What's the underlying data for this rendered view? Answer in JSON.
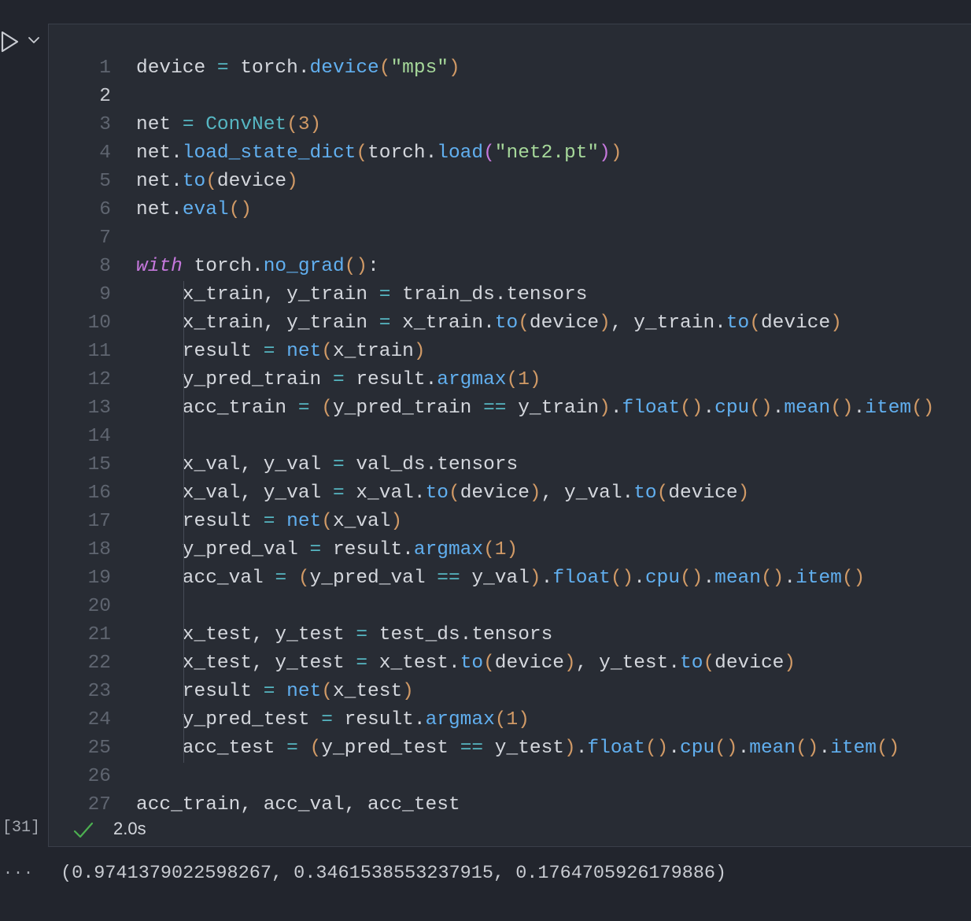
{
  "cell": {
    "execution_count": "[31]",
    "status_time": "2.0s",
    "output_menu": "...",
    "output": "(0.9741379022598267, 0.3461538553237915, 0.1764705926179886)",
    "lines": [
      {
        "n": "1",
        "tokens": [
          [
            "t",
            "device "
          ],
          [
            "op",
            "="
          ],
          [
            "t",
            " torch."
          ],
          [
            "fn",
            "device"
          ],
          [
            "p1",
            "("
          ],
          [
            "str",
            "\"mps\""
          ],
          [
            "p1",
            ")"
          ]
        ]
      },
      {
        "n": "2",
        "tokens": []
      },
      {
        "n": "3",
        "tokens": [
          [
            "t",
            "net "
          ],
          [
            "op",
            "="
          ],
          [
            "t",
            " "
          ],
          [
            "cls",
            "ConvNet"
          ],
          [
            "p1",
            "("
          ],
          [
            "num",
            "3"
          ],
          [
            "p1",
            ")"
          ]
        ]
      },
      {
        "n": "4",
        "tokens": [
          [
            "t",
            "net."
          ],
          [
            "fn",
            "load_state_dict"
          ],
          [
            "p1",
            "("
          ],
          [
            "t",
            "torch."
          ],
          [
            "fn",
            "load"
          ],
          [
            "p2",
            "("
          ],
          [
            "str",
            "\"net2.pt\""
          ],
          [
            "p2",
            ")"
          ],
          [
            "p1",
            ")"
          ]
        ]
      },
      {
        "n": "5",
        "tokens": [
          [
            "t",
            "net."
          ],
          [
            "fn",
            "to"
          ],
          [
            "p1",
            "("
          ],
          [
            "t",
            "device"
          ],
          [
            "p1",
            ")"
          ]
        ]
      },
      {
        "n": "6",
        "tokens": [
          [
            "t",
            "net."
          ],
          [
            "fn",
            "eval"
          ],
          [
            "p1",
            "()"
          ]
        ]
      },
      {
        "n": "7",
        "tokens": []
      },
      {
        "n": "8",
        "tokens": [
          [
            "kw",
            "with"
          ],
          [
            "t",
            " torch."
          ],
          [
            "fn",
            "no_grad"
          ],
          [
            "p1",
            "()"
          ],
          [
            "t",
            ":"
          ]
        ]
      },
      {
        "n": "9",
        "tokens": [
          [
            "t",
            "    x_train, y_train "
          ],
          [
            "op",
            "="
          ],
          [
            "t",
            " train_ds.tensors"
          ]
        ]
      },
      {
        "n": "10",
        "tokens": [
          [
            "t",
            "    x_train, y_train "
          ],
          [
            "op",
            "="
          ],
          [
            "t",
            " x_train."
          ],
          [
            "fn",
            "to"
          ],
          [
            "p1",
            "("
          ],
          [
            "t",
            "device"
          ],
          [
            "p1",
            ")"
          ],
          [
            "t",
            ", y_train."
          ],
          [
            "fn",
            "to"
          ],
          [
            "p1",
            "("
          ],
          [
            "t",
            "device"
          ],
          [
            "p1",
            ")"
          ]
        ]
      },
      {
        "n": "11",
        "tokens": [
          [
            "t",
            "    result "
          ],
          [
            "op",
            "="
          ],
          [
            "t",
            " "
          ],
          [
            "fn",
            "net"
          ],
          [
            "p1",
            "("
          ],
          [
            "t",
            "x_train"
          ],
          [
            "p1",
            ")"
          ]
        ]
      },
      {
        "n": "12",
        "tokens": [
          [
            "t",
            "    y_pred_train "
          ],
          [
            "op",
            "="
          ],
          [
            "t",
            " result."
          ],
          [
            "fn",
            "argmax"
          ],
          [
            "p1",
            "("
          ],
          [
            "num",
            "1"
          ],
          [
            "p1",
            ")"
          ]
        ]
      },
      {
        "n": "13",
        "tokens": [
          [
            "t",
            "    acc_train "
          ],
          [
            "op",
            "="
          ],
          [
            "t",
            " "
          ],
          [
            "p1",
            "("
          ],
          [
            "t",
            "y_pred_train "
          ],
          [
            "op",
            "=="
          ],
          [
            "t",
            " y_train"
          ],
          [
            "p1",
            ")"
          ],
          [
            "t",
            "."
          ],
          [
            "fn",
            "float"
          ],
          [
            "p1",
            "()"
          ],
          [
            "t",
            "."
          ],
          [
            "fn",
            "cpu"
          ],
          [
            "p1",
            "()"
          ],
          [
            "t",
            "."
          ],
          [
            "fn",
            "mean"
          ],
          [
            "p1",
            "()"
          ],
          [
            "t",
            "."
          ],
          [
            "fn",
            "item"
          ],
          [
            "p1",
            "()"
          ]
        ]
      },
      {
        "n": "14",
        "tokens": []
      },
      {
        "n": "15",
        "tokens": [
          [
            "t",
            "    x_val, y_val "
          ],
          [
            "op",
            "="
          ],
          [
            "t",
            " val_ds.tensors"
          ]
        ]
      },
      {
        "n": "16",
        "tokens": [
          [
            "t",
            "    x_val, y_val "
          ],
          [
            "op",
            "="
          ],
          [
            "t",
            " x_val."
          ],
          [
            "fn",
            "to"
          ],
          [
            "p1",
            "("
          ],
          [
            "t",
            "device"
          ],
          [
            "p1",
            ")"
          ],
          [
            "t",
            ", y_val."
          ],
          [
            "fn",
            "to"
          ],
          [
            "p1",
            "("
          ],
          [
            "t",
            "device"
          ],
          [
            "p1",
            ")"
          ]
        ]
      },
      {
        "n": "17",
        "tokens": [
          [
            "t",
            "    result "
          ],
          [
            "op",
            "="
          ],
          [
            "t",
            " "
          ],
          [
            "fn",
            "net"
          ],
          [
            "p1",
            "("
          ],
          [
            "t",
            "x_val"
          ],
          [
            "p1",
            ")"
          ]
        ]
      },
      {
        "n": "18",
        "tokens": [
          [
            "t",
            "    y_pred_val "
          ],
          [
            "op",
            "="
          ],
          [
            "t",
            " result."
          ],
          [
            "fn",
            "argmax"
          ],
          [
            "p1",
            "("
          ],
          [
            "num",
            "1"
          ],
          [
            "p1",
            ")"
          ]
        ]
      },
      {
        "n": "19",
        "tokens": [
          [
            "t",
            "    acc_val "
          ],
          [
            "op",
            "="
          ],
          [
            "t",
            " "
          ],
          [
            "p1",
            "("
          ],
          [
            "t",
            "y_pred_val "
          ],
          [
            "op",
            "=="
          ],
          [
            "t",
            " y_val"
          ],
          [
            "p1",
            ")"
          ],
          [
            "t",
            "."
          ],
          [
            "fn",
            "float"
          ],
          [
            "p1",
            "()"
          ],
          [
            "t",
            "."
          ],
          [
            "fn",
            "cpu"
          ],
          [
            "p1",
            "()"
          ],
          [
            "t",
            "."
          ],
          [
            "fn",
            "mean"
          ],
          [
            "p1",
            "()"
          ],
          [
            "t",
            "."
          ],
          [
            "fn",
            "item"
          ],
          [
            "p1",
            "()"
          ]
        ]
      },
      {
        "n": "20",
        "tokens": []
      },
      {
        "n": "21",
        "tokens": [
          [
            "t",
            "    x_test, y_test "
          ],
          [
            "op",
            "="
          ],
          [
            "t",
            " test_ds.tensors"
          ]
        ]
      },
      {
        "n": "22",
        "tokens": [
          [
            "t",
            "    x_test, y_test "
          ],
          [
            "op",
            "="
          ],
          [
            "t",
            " x_test."
          ],
          [
            "fn",
            "to"
          ],
          [
            "p1",
            "("
          ],
          [
            "t",
            "device"
          ],
          [
            "p1",
            ")"
          ],
          [
            "t",
            ", y_test."
          ],
          [
            "fn",
            "to"
          ],
          [
            "p1",
            "("
          ],
          [
            "t",
            "device"
          ],
          [
            "p1",
            ")"
          ]
        ]
      },
      {
        "n": "23",
        "tokens": [
          [
            "t",
            "    result "
          ],
          [
            "op",
            "="
          ],
          [
            "t",
            " "
          ],
          [
            "fn",
            "net"
          ],
          [
            "p1",
            "("
          ],
          [
            "t",
            "x_test"
          ],
          [
            "p1",
            ")"
          ]
        ]
      },
      {
        "n": "24",
        "tokens": [
          [
            "t",
            "    y_pred_test "
          ],
          [
            "op",
            "="
          ],
          [
            "t",
            " result."
          ],
          [
            "fn",
            "argmax"
          ],
          [
            "p1",
            "("
          ],
          [
            "num",
            "1"
          ],
          [
            "p1",
            ")"
          ]
        ]
      },
      {
        "n": "25",
        "tokens": [
          [
            "t",
            "    acc_test "
          ],
          [
            "op",
            "="
          ],
          [
            "t",
            " "
          ],
          [
            "p1",
            "("
          ],
          [
            "t",
            "y_pred_test "
          ],
          [
            "op",
            "=="
          ],
          [
            "t",
            " y_test"
          ],
          [
            "p1",
            ")"
          ],
          [
            "t",
            "."
          ],
          [
            "fn",
            "float"
          ],
          [
            "p1",
            "()"
          ],
          [
            "t",
            "."
          ],
          [
            "fn",
            "cpu"
          ],
          [
            "p1",
            "()"
          ],
          [
            "t",
            "."
          ],
          [
            "fn",
            "mean"
          ],
          [
            "p1",
            "()"
          ],
          [
            "t",
            "."
          ],
          [
            "fn",
            "item"
          ],
          [
            "p1",
            "()"
          ]
        ]
      },
      {
        "n": "26",
        "tokens": []
      },
      {
        "n": "27",
        "tokens": [
          [
            "t",
            "acc_train, acc_val, acc_test"
          ]
        ]
      }
    ]
  },
  "colors": {
    "background": "#22252d",
    "cell_background": "#282c34",
    "function": "#61afef",
    "string": "#a6d89a",
    "number": "#d19a66",
    "keyword": "#c678dd",
    "success": "#4caf50"
  },
  "icons": {
    "run": "run-icon",
    "chevron": "chevron-down-icon",
    "status": "check-icon"
  }
}
